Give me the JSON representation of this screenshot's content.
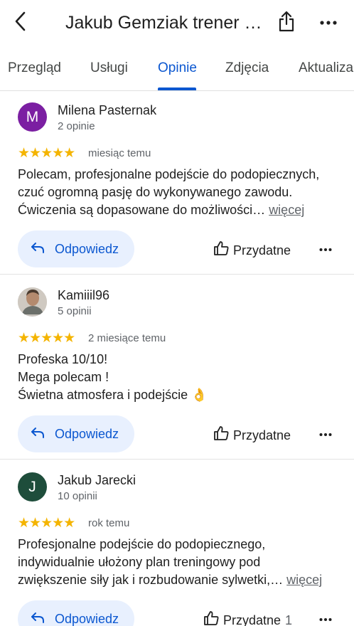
{
  "header": {
    "title": "Jakub Gemziak trener personalny",
    "icons": {
      "back": "back-arrow-icon",
      "share": "share-icon",
      "more": "more-horiz-icon"
    }
  },
  "tabs": [
    {
      "label": "Przegląd",
      "active": false
    },
    {
      "label": "Usługi",
      "active": false
    },
    {
      "label": "Opinie",
      "active": true
    },
    {
      "label": "Zdjęcia",
      "active": false
    },
    {
      "label": "Aktualizacje",
      "active": false
    }
  ],
  "colors": {
    "accent": "#0b57d0",
    "star": "#f4b400",
    "reply_bg": "#e8f0fe"
  },
  "reviews": [
    {
      "author": "Milena Pasternak",
      "initial": "M",
      "avatar_color": "#7b1fa2",
      "count": "2 opinie",
      "rating": 5,
      "stars": "★★★★★",
      "date": "miesiąc temu",
      "lines": [
        "Polecam, profesjonalne podejście do podopiecznych,",
        "czuć ogromną pasję do wykonywanego zawodu.",
        "Ćwiczenia są dopasowane do możliwości…"
      ],
      "more_label": "więcej",
      "reply_label": "Odpowiedz",
      "helpful_label": "Przydatne",
      "helpful_count": ""
    },
    {
      "author": "Kamiiil96",
      "initial": "",
      "avatar_color": "#bdbdbd",
      "count": "5 opinii",
      "rating": 5,
      "stars": "★★★★★",
      "date": "2 miesiące temu",
      "lines": [
        "Profeska 10/10!",
        "Mega polecam !",
        "Świetna atmosfera i podejście 👌"
      ],
      "more_label": "",
      "reply_label": "Odpowiedz",
      "helpful_label": "Przydatne",
      "helpful_count": ""
    },
    {
      "author": "Jakub Jarecki",
      "initial": "J",
      "avatar_color": "#1e4d3b",
      "count": "10 opinii",
      "rating": 5,
      "stars": "★★★★★",
      "date": "rok temu",
      "lines": [
        "Profesjonalne podejście do podopiecznego,",
        "indywidualnie ułożony plan treningowy pod",
        "zwiększenie siły jak i rozbudowanie sylwetki,…"
      ],
      "more_label": "więcej",
      "reply_label": "Odpowiedz",
      "helpful_label": "Przydatne",
      "helpful_count": "1"
    }
  ]
}
